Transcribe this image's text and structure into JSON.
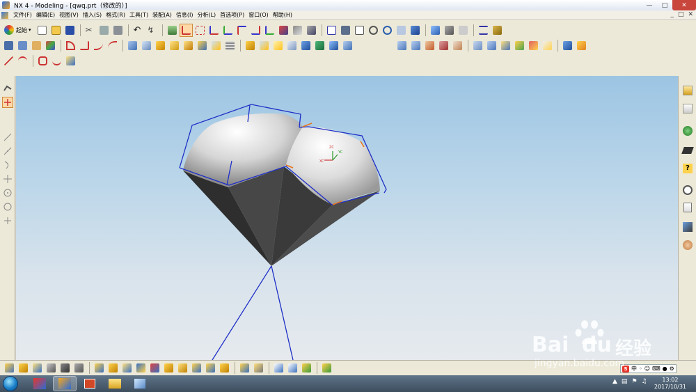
{
  "window": {
    "title": "NX 4 - Modeling - [qwq.prt（修改的）]"
  },
  "menu": {
    "items": [
      "文件(F)",
      "编辑(E)",
      "视图(V)",
      "插入(S)",
      "格式(R)",
      "工具(T)",
      "装配(A)",
      "信息(I)",
      "分析(L)",
      "首选项(P)",
      "窗口(O)",
      "帮助(H)"
    ]
  },
  "toolbar": {
    "start_label": "起始"
  },
  "viewport": {
    "triad_labels": {
      "x": "XC",
      "y": "YC",
      "z": "ZC"
    },
    "colors": {
      "outline": "#1f2fc7",
      "edge_marker": "#e8751a",
      "shade_dark": "#3a3a3a"
    }
  },
  "watermark": {
    "brand": "Bai",
    "du": "du",
    "cn": "经验",
    "url": "jingyan.baidu.com"
  },
  "ime": {
    "label": "中"
  },
  "taskbar": {
    "time": "13:02",
    "date": "2017/10/31"
  }
}
